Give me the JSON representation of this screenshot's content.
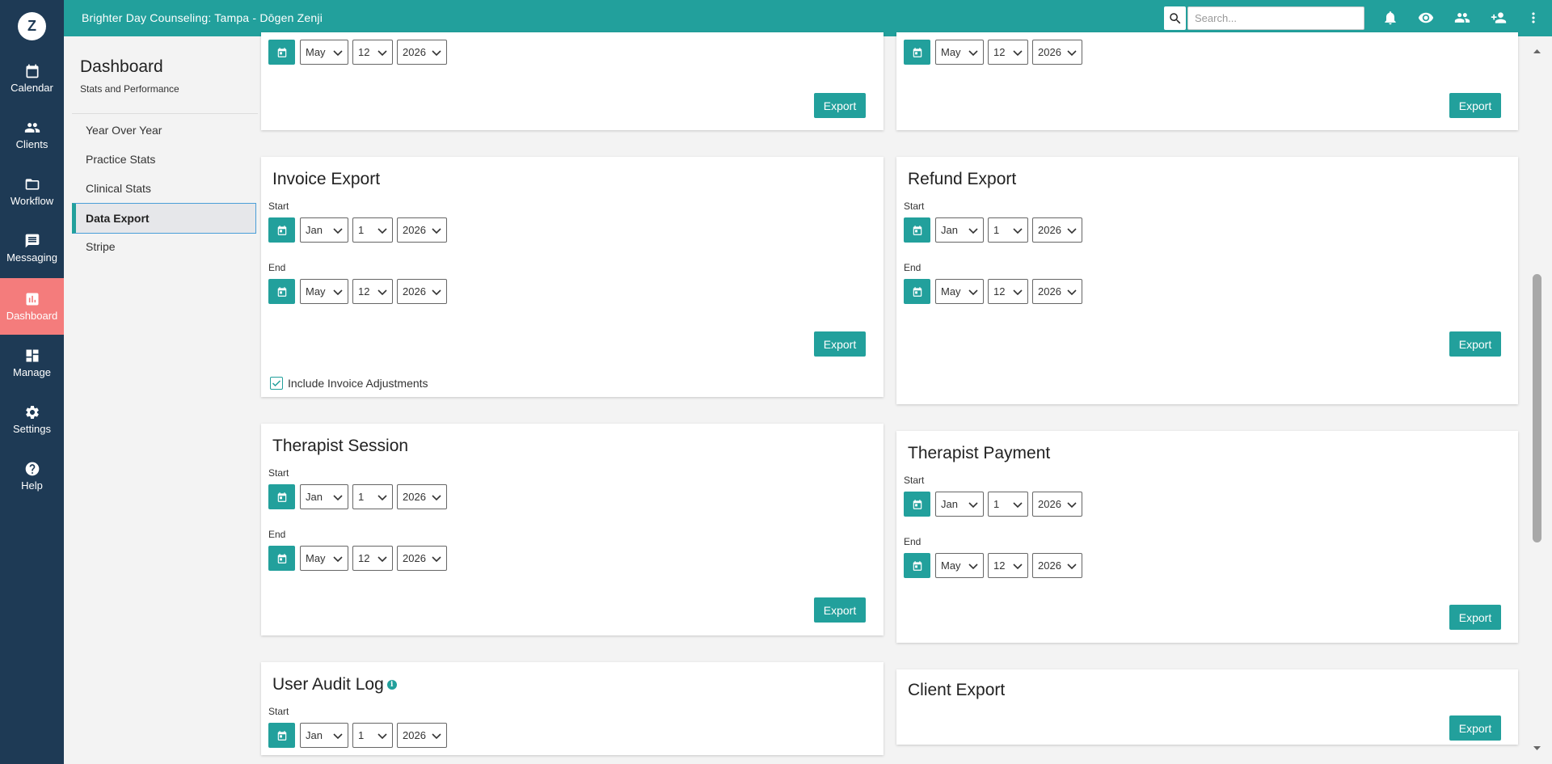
{
  "rail": {
    "logo": "Z",
    "items": [
      {
        "label": "Calendar",
        "icon": "calendar-icon"
      },
      {
        "label": "Clients",
        "icon": "clients-icon"
      },
      {
        "label": "Workflow",
        "icon": "folder-icon"
      },
      {
        "label": "Messaging",
        "icon": "message-icon"
      },
      {
        "label": "Dashboard",
        "icon": "chart-icon"
      },
      {
        "label": "Manage",
        "icon": "grid-icon"
      },
      {
        "label": "Settings",
        "icon": "gear-icon"
      },
      {
        "label": "Help",
        "icon": "help-icon"
      }
    ]
  },
  "topbar": {
    "title": "Brighter Day Counseling: Tampa - Dōgen Zenji",
    "search_placeholder": "Search...",
    "icons": [
      "bell-icon",
      "eye-icon",
      "group-icon",
      "add-person-icon",
      "more-vertical-icon"
    ]
  },
  "subnav": {
    "title": "Dashboard",
    "subtitle": "Stats and Performance",
    "items": [
      "Year Over Year",
      "Practice Stats",
      "Clinical Stats",
      "Data Export",
      "Stripe"
    ],
    "active": "Data Export"
  },
  "labels": {
    "start": "Start",
    "end": "End",
    "export": "Export"
  },
  "dates": {
    "start": {
      "month": "Jan",
      "day": "1",
      "year": "2026"
    },
    "end": {
      "month": "May",
      "day": "12",
      "year": "2026"
    }
  },
  "cards": {
    "top_left": {},
    "top_right": {},
    "invoice": {
      "title": "Invoice Export",
      "checkbox_label": "Include Invoice Adjustments",
      "checked": true
    },
    "refund": {
      "title": "Refund Export"
    },
    "therapist_session": {
      "title": "Therapist Session"
    },
    "therapist_payment": {
      "title": "Therapist Payment"
    },
    "user_audit": {
      "title": "User Audit Log",
      "info": "i"
    },
    "client_export": {
      "title": "Client Export"
    }
  },
  "colors": {
    "rail": "#1e3a55",
    "accent": "#22a09c",
    "active_rail": "#f47c7c",
    "background": "#f3f3f3"
  }
}
